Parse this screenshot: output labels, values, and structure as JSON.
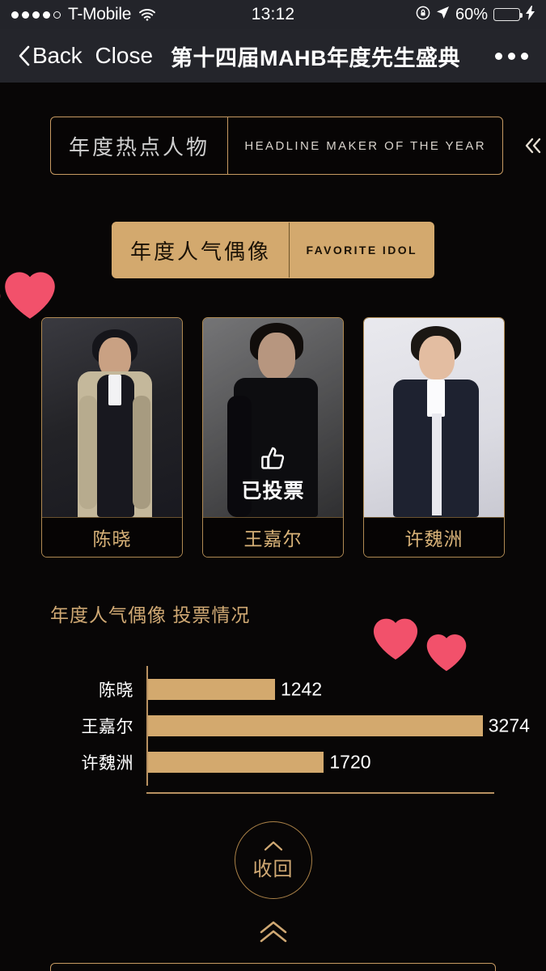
{
  "status_bar": {
    "signal_dots_filled": 4,
    "signal_dots_total": 5,
    "carrier": "T-Mobile",
    "wifi_icon": "wifi-icon",
    "time": "13:12",
    "rotation_lock_icon": "rotation-lock-icon",
    "location_icon": "location-arrow-icon",
    "battery_percent": "60%",
    "battery_level": 60,
    "charging_icon": "lightning-bolt-icon",
    "battery_color": "#ffd400"
  },
  "nav_bar": {
    "back_icon": "chevron-left-icon",
    "back_label": "Back",
    "close_label": "Close",
    "title": "第十四届MAHB年度先生盛典",
    "more_icon": "more-horizontal-icon"
  },
  "categories": [
    {
      "cn": "年度热点人物",
      "en": "HEADLINE MAKER OF THE YEAR",
      "active": false,
      "collapse_icon": "double-chevron-left-icon"
    },
    {
      "cn": "年度人气偶像",
      "en": "FAVORITE IDOL",
      "active": true
    }
  ],
  "candidates": [
    {
      "name": "陈晓",
      "voted": false
    },
    {
      "name": "王嘉尔",
      "voted": true,
      "voted_label": "已投票",
      "voted_icon": "thumbs-up-icon"
    },
    {
      "name": "许魏洲",
      "voted": false
    }
  ],
  "collapse": {
    "chevron_icon": "chevron-up-icon",
    "label": "收回",
    "scroll_icon": "double-chevron-up-icon"
  },
  "theme": {
    "gold": "#d3a96e",
    "gold_border": "#c79a62",
    "gold_text": "#cfa873",
    "background": "#080606",
    "heart": "#f2516b"
  },
  "chart_data": {
    "type": "bar",
    "orientation": "horizontal",
    "title": "年度人气偶像 投票情况",
    "categories": [
      "陈晓",
      "王嘉尔",
      "许魏洲"
    ],
    "values": [
      1242,
      3274,
      1720
    ],
    "value_labels": [
      "1242",
      "3274",
      "1720"
    ],
    "bar_color": "#d3a96e",
    "axis_color": "#b89161",
    "label_color": "#ffffff",
    "xlabel": "",
    "ylabel": "",
    "xlim": [
      0,
      3274
    ],
    "grid": false,
    "legend": false
  }
}
